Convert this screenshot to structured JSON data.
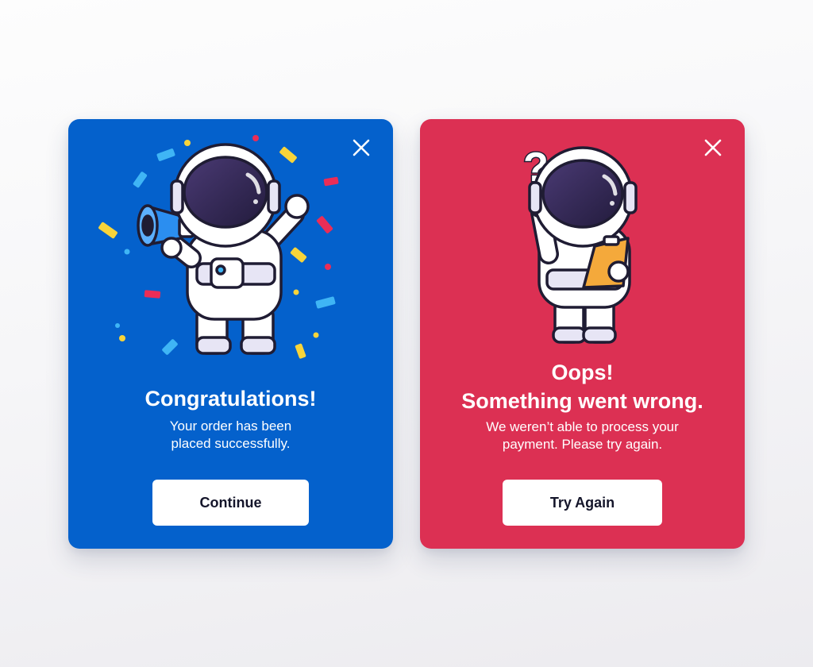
{
  "success_card": {
    "title": "Congratulations!",
    "message": "Your order has been\nplaced successfully.",
    "button_label": "Continue",
    "close_icon": "close-icon",
    "illustration": "astronaut-megaphone-confetti",
    "background_color": "#0461cc"
  },
  "error_card": {
    "title_line1": "Oops!",
    "title_line2": "Something went wrong.",
    "message": "We weren’t able to process your\npayment. Please try again.",
    "button_label": "Try Again",
    "close_icon": "close-icon",
    "illustration": "astronaut-question-clipboard",
    "background_color": "#dc3053"
  },
  "colors": {
    "button_bg": "#ffffff",
    "button_text": "#14152a",
    "confetti": [
      "#f8d43a",
      "#ea2d57",
      "#3fb5f5"
    ]
  }
}
